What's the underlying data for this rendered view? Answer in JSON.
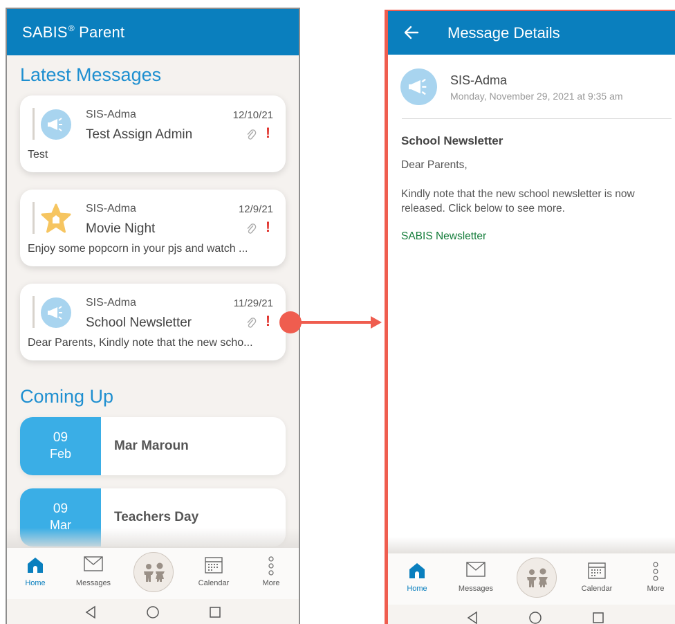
{
  "left": {
    "app_title": "SABIS",
    "app_title_mark": "®",
    "app_title_suffix": " Parent",
    "latest_title": "Latest Messages",
    "messages": [
      {
        "sender": "SIS-Adma",
        "date": "12/10/21",
        "subject": "Test Assign Admin",
        "preview": "Test",
        "icon": "megaphone-icon"
      },
      {
        "sender": "SIS-Adma",
        "date": "12/9/21",
        "subject": "Movie Night",
        "preview": "Enjoy some popcorn in your pjs and watch ...",
        "icon": "star-icon"
      },
      {
        "sender": "SIS-Adma",
        "date": "11/29/21",
        "subject": "School Newsletter",
        "preview": "Dear Parents, Kindly note that the new scho...",
        "icon": "megaphone-icon"
      }
    ],
    "important_mark": "!",
    "coming_title": "Coming Up",
    "events": [
      {
        "day": "09",
        "month": "Feb",
        "name": "Mar Maroun"
      },
      {
        "day": "09",
        "month": "Mar",
        "name": "Teachers Day"
      }
    ]
  },
  "tabs": {
    "home": "Home",
    "messages": "Messages",
    "calendar": "Calendar",
    "more": "More"
  },
  "right": {
    "title": "Message Details",
    "sender": "SIS-Adma",
    "date": "Monday, November 29, 2021 at 9:35 am",
    "subject": "School Newsletter",
    "body_greeting": "Dear Parents,",
    "body_text": "Kindly note that the new school newsletter is now released. Click below to see more.",
    "link": "SABIS Newsletter"
  },
  "colors": {
    "brand_blue": "#0a7fbe",
    "accent_red": "#ef5d4f",
    "event_blue": "#3aaee6",
    "link_green": "#137c3a"
  }
}
